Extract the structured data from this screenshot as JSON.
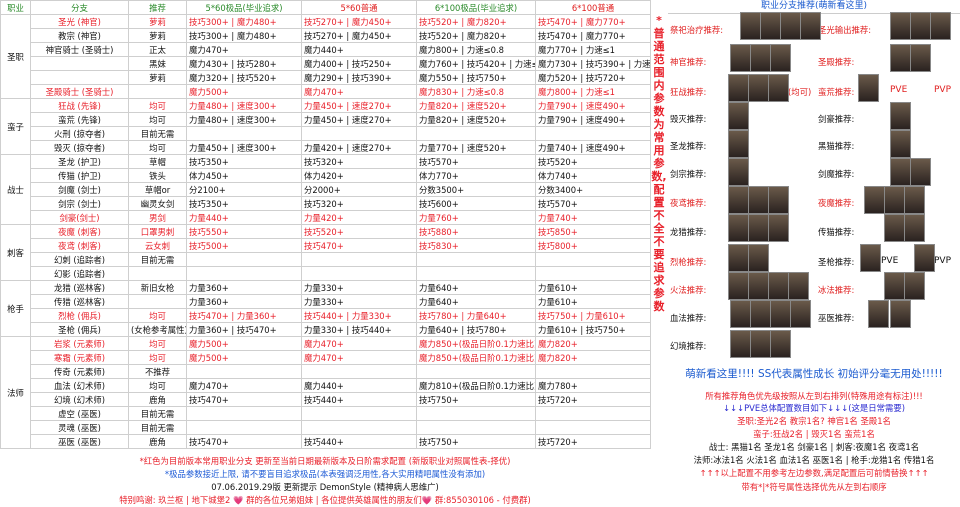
{
  "header": {
    "job": "职业",
    "branch": "分支",
    "recommend": "推荐",
    "col1": "5*60极品(毕业追求)",
    "col2": "5*60普通",
    "col3": "6*100极品(毕业追求)",
    "col4": "6*100普通"
  },
  "groups": [
    {
      "job": "圣职",
      "rows": [
        {
          "branch": "圣光 (神官)",
          "rec": "萝莉",
          "c1": "技巧300+ | 魔力480+",
          "c2": "技巧270+ | 魔力450+",
          "c3": "技巧520+ | 魔力820+",
          "c4": "技巧470+ | 魔力770+",
          "red": true
        },
        {
          "branch": "教宗 (神官)",
          "rec": "萝莉",
          "c1": "技巧300+ | 魔力480+",
          "c2": "技巧270+ | 魔力450+",
          "c3": "技巧520+ | 魔力820+",
          "c4": "技巧470+ | 魔力770+"
        },
        {
          "branch": "神官骑士 (圣骑士)",
          "rec": "正太",
          "c1": "魔力470+",
          "c2": "魔力440+",
          "c3": "魔力800+ | 力速≤0.8",
          "c4": "魔力770+ | 力速≤1"
        },
        {
          "branch": "",
          "rec": "黑妹",
          "c1": "魔力430+ | 技巧280+",
          "c2": "魔力400+ | 技巧250+",
          "c3": "魔力760+ | 技巧420+ | 力速≤0.8",
          "c4": "魔力730+ | 技巧390+ | 力速≤1"
        },
        {
          "branch": "",
          "rec": "萝莉",
          "c1": "魔力320+ | 技巧520+",
          "c2": "魔力290+ | 技巧390+",
          "c3": "魔力550+ | 技巧750+",
          "c4": "魔力520+ | 技巧720+"
        },
        {
          "branch": "圣殿骑士 (圣骑士)",
          "rec": "",
          "c1": "魔力500+",
          "c2": "魔力470+",
          "c3": "魔力830+ | 力速≤0.8",
          "c4": "魔力800+ | 力速≤1",
          "red": true
        }
      ]
    },
    {
      "job": "蛮子",
      "rows": [
        {
          "branch": "狂战 (先锋)",
          "rec": "均可",
          "c1": "力量480+ | 速度300+",
          "c2": "力量450+ | 速度270+",
          "c3": "力量820+ | 速度520+",
          "c4": "力量790+ | 速度490+",
          "red": true
        },
        {
          "branch": "蛮荒 (先锋)",
          "rec": "均可",
          "c1": "力量480+ | 速度300+",
          "c2": "力量450+ | 速度270+",
          "c3": "力量820+ | 速度520+",
          "c4": "力量790+ | 速度490+"
        },
        {
          "branch": "火刑 (掠夺者)",
          "rec": "目前无需",
          "c1": "",
          "c2": "",
          "c3": "",
          "c4": ""
        },
        {
          "branch": "毁灭 (掠夺者)",
          "rec": "均可",
          "c1": "力量450+ | 速度300+",
          "c2": "力量420+ | 速度270+",
          "c3": "力量770+ | 速度520+",
          "c4": "力量740+ | 速度490+"
        }
      ]
    },
    {
      "job": "战士",
      "rows": [
        {
          "branch": "圣龙 (护卫)",
          "rec": "草帽",
          "c1": "技巧350+",
          "c2": "技巧320+",
          "c3": "技巧570+",
          "c4": "技巧520+"
        },
        {
          "branch": "传猫 (护卫)",
          "rec": "铁头",
          "c1": "体力450+",
          "c2": "体力420+",
          "c3": "体力770+",
          "c4": "体力740+"
        },
        {
          "branch": "剑魔 (剑士)",
          "rec": "草帽or",
          "c1": "分2100+",
          "c2": "分2000+",
          "c3": "分数3500+",
          "c4": "分数3400+"
        },
        {
          "branch": "剑宗 (剑士)",
          "rec": "幽灵女剑",
          "c1": "技巧350+",
          "c2": "技巧320+",
          "c3": "技巧600+",
          "c4": "技巧570+"
        },
        {
          "branch": "剑豪(剑士)",
          "rec": "男剑",
          "c1": "力量440+",
          "c2": "力量420+",
          "c3": "力量760+",
          "c4": "力量740+",
          "red": true
        }
      ]
    },
    {
      "job": "刺客",
      "rows": [
        {
          "branch": "夜魔 (刺客)",
          "rec": "口罩男刺",
          "c1": "技巧550+",
          "c2": "技巧520+",
          "c3": "技巧880+",
          "c4": "技巧850+",
          "red": true
        },
        {
          "branch": "夜鸢 (刺客)",
          "rec": "云女刺",
          "c1": "技巧500+",
          "c2": "技巧470+",
          "c3": "技巧830+",
          "c4": "技巧800+",
          "red": true
        },
        {
          "branch": "幻刺 (追踪者)",
          "rec": "目前无需",
          "c1": "",
          "c2": "",
          "c3": "",
          "c4": ""
        },
        {
          "branch": "幻影 (追踪者)",
          "rec": "",
          "c1": "",
          "c2": "",
          "c3": "",
          "c4": ""
        }
      ]
    },
    {
      "job": "枪手",
      "rows": [
        {
          "branch": "龙猎 (巡林客)",
          "rec": "新旧女枪",
          "c1": "力量360+",
          "c2": "力量330+",
          "c3": "力量640+",
          "c4": "力量610+"
        },
        {
          "branch": "传猎 (巡林客)",
          "rec": "",
          "c1": "力量360+",
          "c2": "力量330+",
          "c3": "力量640+",
          "c4": "力量610+"
        },
        {
          "branch": "烈枪 (佣兵)",
          "rec": "均可",
          "c1": "技巧470+ | 力量360+",
          "c2": "技巧440+ | 力量330+",
          "c3": "技巧780+ | 力量640+",
          "c4": "技巧750+ | 力量610+",
          "red": true
        },
        {
          "branch": "圣枪 (佣兵)",
          "rec": "(女枪参考属性)",
          "c1": "力量360+ | 技巧470+",
          "c2": "力量330+ | 技巧440+",
          "c3": "力量640+ | 技巧780+",
          "c4": "力量610+ | 技巧750+"
        }
      ]
    },
    {
      "job": "法师",
      "rows": [
        {
          "branch": "岩浆 (元素师)",
          "rec": "均可",
          "c1": "魔力500+",
          "c2": "魔力470+",
          "c3": "魔力850+(极品日阶0.1力速比)",
          "c4": "魔力820+",
          "red": true
        },
        {
          "branch": "寒霜 (元素师)",
          "rec": "均可",
          "c1": "魔力500+",
          "c2": "魔力470+",
          "c3": "魔力850+(极品日阶0.1力速比)",
          "c4": "魔力820+",
          "red": true
        },
        {
          "branch": "传奇 (元素师)",
          "rec": "不推荐",
          "c1": "",
          "c2": "",
          "c3": "",
          "c4": ""
        },
        {
          "branch": "血法 (幻术师)",
          "rec": "均可",
          "c1": "魔力470+",
          "c2": "魔力440+",
          "c3": "魔力810+(极品日阶0.1力速比)",
          "c4": "魔力780+"
        },
        {
          "branch": "幻境 (幻术师)",
          "rec": "鹿角",
          "c1": "技巧470+",
          "c2": "技巧440+",
          "c3": "技巧750+",
          "c4": "技巧720+"
        },
        {
          "branch": "虚空 (巫医)",
          "rec": "目前无需",
          "c1": "",
          "c2": "",
          "c3": "",
          "c4": ""
        },
        {
          "branch": "灵魂 (巫医)",
          "rec": "目前无需",
          "c1": "",
          "c2": "",
          "c3": "",
          "c4": ""
        },
        {
          "branch": "巫医 (巫医)",
          "rec": "鹿角",
          "c1": "技巧470+",
          "c2": "技巧440+",
          "c3": "技巧750+",
          "c4": "技巧720+"
        }
      ]
    }
  ],
  "notes": {
    "n1": "*红色为目前版本常用职业分支  更新至当前日期最新版本及日阶需求配置  (新版职业对照属性表-择优)",
    "n2": "*极品参数接近上限, 请不要盲目追求极品(本表强调泛用性,各大实用精吧属性没有添加)",
    "n3": "07.06.2019.29版  更新提示  DemonStyle (精神病人思维广)",
    "n4": "特别鸣谢:        玖兰枢 | 地下城堡2 💗 群的各位兄弟姐妹 | 各位提供英雄属性的朋友们💗  群:855030106 - 付费群)"
  },
  "vertical": "*普通范围内参数为常用参数, 配置不全不要追求参数",
  "right": {
    "title": "职业分支推荐(萌新看这里)",
    "labels": {
      "a": "祭祀治疗推荐:",
      "b": "圣光输出推荐:",
      "c": "神官推荐:",
      "d": "圣殿推荐:",
      "e": "狂战推荐:",
      "f": "(均可)",
      "g": "蛮荒推荐:",
      "h": "毁灭推荐:",
      "i": "剑豪推荐:",
      "j": "圣龙推荐:",
      "k": "黑猫推荐:",
      "l": "剑宗推荐:",
      "m": "剑魔推荐:",
      "n": "夜鸢推荐:",
      "o": "夜魔推荐:",
      "p": "龙猎推荐:",
      "q": "传猫推荐:",
      "r": "烈枪推荐:",
      "s": "圣枪推荐:",
      "t": "火法推荐:",
      "u": "冰法推荐:",
      "v": "血法推荐:",
      "w": "巫医推荐:",
      "x": "幻境推荐:"
    },
    "pve1": "PVE",
    "pvp1": "PVP",
    "pve2": "PVE",
    "pvp2": "PVP",
    "bigline": "萌新看这里!!!!   SS代表属性成长 初始评分毫无用处!!!!!",
    "l1": "所有推荐角色优先级按照从左到右排列(特殊用途有标注)!!!",
    "l2": "↓↓↓PVE总体配置数目如下↓↓↓(这是日常需要)",
    "l3": "圣职:圣光2名 教宗1名? 神官1名 圣殿1名",
    "l4": "蛮子:狂战2名 | 毁灭1名 蛮荒1名",
    "l5": "战士: 黑猫1名 圣龙1名 剑豪1名 | 刺客:夜魔1名 夜鸢1名",
    "l6": "法师:冰法1名 火法1名 血法1名 巫医1名 | 枪手:龙猎1名 传猎1名",
    "l7": "↑↑↑以上配置不用参考左边参数,满足配置后可前情替换↑↑↑",
    "l8": "带有*|*符号属性选择优先从左到右顺序"
  }
}
